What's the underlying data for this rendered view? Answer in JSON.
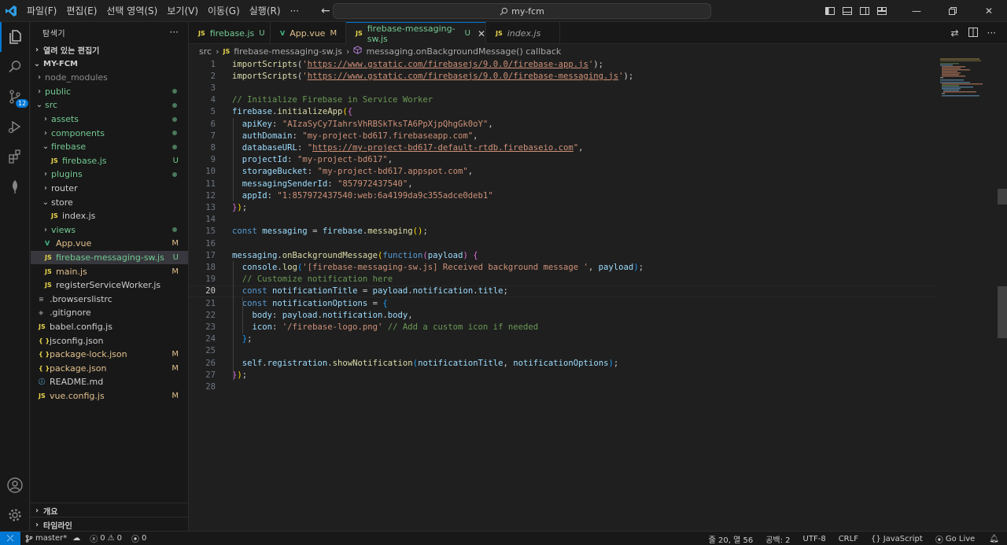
{
  "titlebar": {
    "menu": [
      "파일(F)",
      "편집(E)",
      "선택 영역(S)",
      "보기(V)",
      "이동(G)",
      "실행(R)",
      "···"
    ],
    "command_center": "my-fcm"
  },
  "activitybar": {
    "scm_badge": "12"
  },
  "sidebar": {
    "title": "탐색기",
    "open_editors": "열려 있는 편집기",
    "project": "MY-FCM",
    "outline": "개요",
    "timeline": "타임라인",
    "tree": [
      {
        "label": "node_modules",
        "type": "folder",
        "open": false,
        "depth": 1,
        "state": "dim"
      },
      {
        "label": "public",
        "type": "folder",
        "open": false,
        "depth": 1,
        "state": "dot"
      },
      {
        "label": "src",
        "type": "folder",
        "open": true,
        "depth": 1,
        "state": "dot"
      },
      {
        "label": "assets",
        "type": "folder",
        "open": false,
        "depth": 2,
        "state": "dot"
      },
      {
        "label": "components",
        "type": "folder",
        "open": false,
        "depth": 2,
        "state": "dot"
      },
      {
        "label": "firebase",
        "type": "folder",
        "open": true,
        "depth": 2,
        "state": "dot"
      },
      {
        "label": "firebase.js",
        "type": "js",
        "depth": 3,
        "state": "U"
      },
      {
        "label": "plugins",
        "type": "folder",
        "open": false,
        "depth": 2,
        "state": "dot"
      },
      {
        "label": "router",
        "type": "folder",
        "open": false,
        "depth": 2,
        "state": ""
      },
      {
        "label": "store",
        "type": "folder",
        "open": true,
        "depth": 2,
        "state": ""
      },
      {
        "label": "index.js",
        "type": "js",
        "depth": 3,
        "state": ""
      },
      {
        "label": "views",
        "type": "folder",
        "open": false,
        "depth": 2,
        "state": "dot"
      },
      {
        "label": "App.vue",
        "type": "vue",
        "depth": 2,
        "state": "M"
      },
      {
        "label": "firebase-messaging-sw.js",
        "type": "js",
        "depth": 2,
        "state": "U",
        "selected": true
      },
      {
        "label": "main.js",
        "type": "js",
        "depth": 2,
        "state": "M"
      },
      {
        "label": "registerServiceWorker.js",
        "type": "js",
        "depth": 2,
        "state": ""
      },
      {
        "label": ".browserslistrc",
        "type": "lines",
        "depth": 1,
        "state": ""
      },
      {
        "label": ".gitignore",
        "type": "git",
        "depth": 1,
        "state": ""
      },
      {
        "label": "babel.config.js",
        "type": "js",
        "depth": 1,
        "state": ""
      },
      {
        "label": "jsconfig.json",
        "type": "json",
        "depth": 1,
        "state": ""
      },
      {
        "label": "package-lock.json",
        "type": "json",
        "depth": 1,
        "state": "M"
      },
      {
        "label": "package.json",
        "type": "json",
        "depth": 1,
        "state": "M"
      },
      {
        "label": "README.md",
        "type": "info",
        "depth": 1,
        "state": ""
      },
      {
        "label": "vue.config.js",
        "type": "js",
        "depth": 1,
        "state": "M"
      }
    ]
  },
  "tabs": [
    {
      "icon": "JS",
      "label": "firebase.js",
      "status": "U",
      "active": false
    },
    {
      "icon": "V",
      "label": "App.vue",
      "status": "M",
      "active": false
    },
    {
      "icon": "JS",
      "label": "firebase-messaging-sw.js",
      "status": "U",
      "active": true
    },
    {
      "icon": "JS",
      "label": "index.js",
      "status": "",
      "active": false
    }
  ],
  "breadcrumb": {
    "folder": "src",
    "file_icon": "JS",
    "file": "firebase-messaging-sw.js",
    "symbol": "messaging.onBackgroundMessage() callback"
  },
  "editor": {
    "current_line": 20,
    "lines": [
      [
        [
          "fn",
          "importScripts"
        ],
        [
          "pn",
          "("
        ],
        [
          "str",
          "'"
        ],
        [
          "url",
          "https://www.gstatic.com/firebasejs/9.0.0/firebase-app.js"
        ],
        [
          "str",
          "'"
        ],
        [
          "pn",
          ");"
        ]
      ],
      [
        [
          "fn",
          "importScripts"
        ],
        [
          "pn",
          "("
        ],
        [
          "str",
          "'"
        ],
        [
          "url",
          "https://www.gstatic.com/firebasejs/9.0.0/firebase-messaging.js"
        ],
        [
          "str",
          "'"
        ],
        [
          "pn",
          ");"
        ]
      ],
      [],
      [
        [
          "cm",
          "// Initialize Firebase in Service Worker"
        ]
      ],
      [
        [
          "var",
          "firebase"
        ],
        [
          "pn",
          "."
        ],
        [
          "fn",
          "initializeApp"
        ],
        [
          "br",
          "("
        ],
        [
          "br2",
          "{"
        ]
      ],
      [
        [
          "pn",
          "  "
        ],
        [
          "pr",
          "apiKey"
        ],
        [
          "pn",
          ": "
        ],
        [
          "str",
          "\"AIzaSyCy7IahrsVhRBSkTksTA6PpXjpQhgGk0oY\""
        ],
        [
          "pn",
          ","
        ]
      ],
      [
        [
          "pn",
          "  "
        ],
        [
          "pr",
          "authDomain"
        ],
        [
          "pn",
          ": "
        ],
        [
          "str",
          "\"my-project-bd617.firebaseapp.com\""
        ],
        [
          "pn",
          ","
        ]
      ],
      [
        [
          "pn",
          "  "
        ],
        [
          "pr",
          "databaseURL"
        ],
        [
          "pn",
          ": "
        ],
        [
          "str",
          "\""
        ],
        [
          "url",
          "https://my-project-bd617-default-rtdb.firebaseio.com"
        ],
        [
          "str",
          "\""
        ],
        [
          "pn",
          ","
        ]
      ],
      [
        [
          "pn",
          "  "
        ],
        [
          "pr",
          "projectId"
        ],
        [
          "pn",
          ": "
        ],
        [
          "str",
          "\"my-project-bd617\""
        ],
        [
          "pn",
          ","
        ]
      ],
      [
        [
          "pn",
          "  "
        ],
        [
          "pr",
          "storageBucket"
        ],
        [
          "pn",
          ": "
        ],
        [
          "str",
          "\"my-project-bd617.appspot.com\""
        ],
        [
          "pn",
          ","
        ]
      ],
      [
        [
          "pn",
          "  "
        ],
        [
          "pr",
          "messagingSenderId"
        ],
        [
          "pn",
          ": "
        ],
        [
          "str",
          "\"857972437540\""
        ],
        [
          "pn",
          ","
        ]
      ],
      [
        [
          "pn",
          "  "
        ],
        [
          "pr",
          "appId"
        ],
        [
          "pn",
          ": "
        ],
        [
          "str",
          "\"1:857972437540:web:6a4199da9c355adce0deb1\""
        ]
      ],
      [
        [
          "br2",
          "}"
        ],
        [
          "br",
          ")"
        ],
        [
          "pn",
          ";"
        ]
      ],
      [],
      [
        [
          "kw",
          "const "
        ],
        [
          "var",
          "messaging"
        ],
        [
          "pn",
          " = "
        ],
        [
          "var",
          "firebase"
        ],
        [
          "pn",
          "."
        ],
        [
          "fn",
          "messaging"
        ],
        [
          "br",
          "("
        ],
        [
          "br",
          ")"
        ],
        [
          "pn",
          ";"
        ]
      ],
      [],
      [
        [
          "var",
          "messaging"
        ],
        [
          "pn",
          "."
        ],
        [
          "fn",
          "onBackgroundMessage"
        ],
        [
          "br",
          "("
        ],
        [
          "kw",
          "function"
        ],
        [
          "br2",
          "("
        ],
        [
          "var",
          "payload"
        ],
        [
          "br2",
          ")"
        ],
        [
          "pn",
          " "
        ],
        [
          "br2",
          "{"
        ]
      ],
      [
        [
          "pn",
          "  "
        ],
        [
          "var",
          "console"
        ],
        [
          "pn",
          "."
        ],
        [
          "fn",
          "log"
        ],
        [
          "br3",
          "("
        ],
        [
          "str",
          "'[firebase-messaging-sw.js] Received background message '"
        ],
        [
          "pn",
          ", "
        ],
        [
          "var",
          "payload"
        ],
        [
          "br3",
          ")"
        ],
        [
          "pn",
          ";"
        ]
      ],
      [
        [
          "pn",
          "  "
        ],
        [
          "cm",
          "// Customize notification here"
        ]
      ],
      [
        [
          "pn",
          "  "
        ],
        [
          "kw",
          "const "
        ],
        [
          "var",
          "notificationTitle"
        ],
        [
          "pn",
          " = "
        ],
        [
          "var",
          "payload"
        ],
        [
          "pn",
          "."
        ],
        [
          "var",
          "notification"
        ],
        [
          "pn",
          "."
        ],
        [
          "var",
          "title"
        ],
        [
          "pn",
          ";"
        ]
      ],
      [
        [
          "pn",
          "  "
        ],
        [
          "kw",
          "const "
        ],
        [
          "var",
          "notificationOptions"
        ],
        [
          "pn",
          " = "
        ],
        [
          "br3",
          "{"
        ]
      ],
      [
        [
          "pn",
          "    "
        ],
        [
          "pr",
          "body"
        ],
        [
          "pn",
          ": "
        ],
        [
          "var",
          "payload"
        ],
        [
          "pn",
          "."
        ],
        [
          "var",
          "notification"
        ],
        [
          "pn",
          "."
        ],
        [
          "var",
          "body"
        ],
        [
          "pn",
          ","
        ]
      ],
      [
        [
          "pn",
          "    "
        ],
        [
          "pr",
          "icon"
        ],
        [
          "pn",
          ": "
        ],
        [
          "str",
          "'/firebase-logo.png'"
        ],
        [
          "pn",
          " "
        ],
        [
          "cm",
          "// Add a custom icon if needed"
        ]
      ],
      [
        [
          "pn",
          "  "
        ],
        [
          "br3",
          "}"
        ],
        [
          "pn",
          ";"
        ]
      ],
      [],
      [
        [
          "pn",
          "  "
        ],
        [
          "var",
          "self"
        ],
        [
          "pn",
          "."
        ],
        [
          "var",
          "registration"
        ],
        [
          "pn",
          "."
        ],
        [
          "fn",
          "showNotification"
        ],
        [
          "br3",
          "("
        ],
        [
          "var",
          "notificationTitle"
        ],
        [
          "pn",
          ", "
        ],
        [
          "var",
          "notificationOptions"
        ],
        [
          "br3",
          ")"
        ],
        [
          "pn",
          ";"
        ]
      ],
      [
        [
          "br2",
          "}"
        ],
        [
          "br",
          ")"
        ],
        [
          "pn",
          ";"
        ]
      ],
      []
    ]
  },
  "statusbar": {
    "branch": "master*",
    "errors": "0",
    "warnings": "0",
    "ports": "0",
    "position": "줄 20, 열 56",
    "indent": "공백: 2",
    "encoding": "UTF-8",
    "eol": "CRLF",
    "language": "JavaScript",
    "golive": "Go Live"
  }
}
